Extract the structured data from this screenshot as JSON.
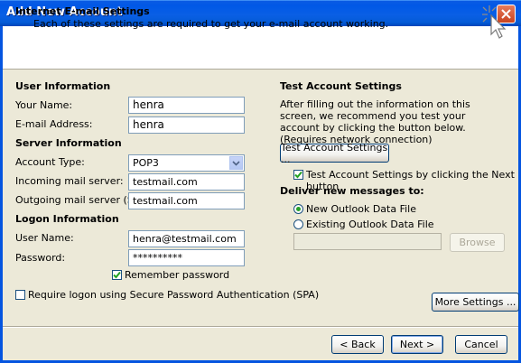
{
  "window": {
    "title": "Add New Account",
    "close_icon": "close-icon"
  },
  "header": {
    "title": "Internet E-mail Settings",
    "subtitle": "Each of these settings are required to get your e-mail account working.",
    "icon": "cursor-sparkle-icon"
  },
  "user_info": {
    "heading": "User Information",
    "name_label": "Your Name:",
    "name_value": "henra",
    "email_label": "E-mail Address:",
    "email_value": "henra"
  },
  "server_info": {
    "heading": "Server Information",
    "account_type_label": "Account Type:",
    "account_type_value": "POP3",
    "incoming_label": "Incoming mail server:",
    "incoming_value": "testmail.com",
    "outgoing_label": "Outgoing mail server (SMTP):",
    "outgoing_value": "testmail.com"
  },
  "logon_info": {
    "heading": "Logon Information",
    "username_label": "User Name:",
    "username_value": "henra@testmail.com",
    "password_label": "Password:",
    "password_value": "**********",
    "remember_label": "Remember password",
    "remember_checked": true,
    "spa_label": "Require logon using Secure Password Authentication (SPA)",
    "spa_checked": false
  },
  "test_settings": {
    "heading": "Test Account Settings",
    "description": "After filling out the information on this screen, we recommend you test your account by clicking the button below. (Requires network connection)",
    "test_button": "Test Account Settings ...",
    "test_next_label": "Test Account Settings by clicking the Next button",
    "test_next_checked": true
  },
  "deliver": {
    "heading": "Deliver new messages to:",
    "option_new": "New Outlook Data File",
    "option_existing": "Existing Outlook Data File",
    "selected": "new",
    "browse_button": "Browse"
  },
  "buttons": {
    "more_settings": "More Settings ...",
    "back": "< Back",
    "next": "Next >",
    "cancel": "Cancel"
  },
  "colors": {
    "titlebar": "#0058e6",
    "dialog_bg": "#ece9d8",
    "check_green": "#21a121"
  }
}
